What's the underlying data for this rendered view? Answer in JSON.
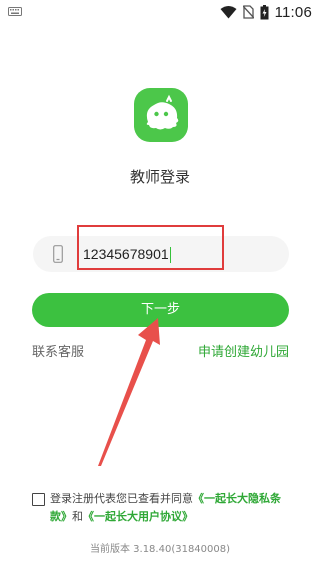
{
  "status_bar": {
    "time": "11:06",
    "icons": [
      "keyboard-icon",
      "wifi-icon",
      "no-sim-icon",
      "battery-icon"
    ]
  },
  "logo": {
    "icon": "app-logo-icon",
    "color": "#4cc74a"
  },
  "page": {
    "title": "教师登录"
  },
  "login_form": {
    "phone_icon": "phone-icon",
    "phone_value": "12345678901",
    "next_label": "下一步",
    "contact_label": "联系客服",
    "apply_label": "申请创建幼儿园"
  },
  "agreement": {
    "checked": false,
    "text_prefix": "登录注册代表您已查看并同意",
    "privacy_link": "《一起长大隐私条款》",
    "and_text": "和",
    "user_link": "《一起长大用户协议》"
  },
  "footer": {
    "version": "当前版本 3.18.40(31840008)"
  },
  "colors": {
    "accent_green": "#3cc140",
    "link_green": "#2fa836",
    "annotation_red": "#e03c3c"
  }
}
